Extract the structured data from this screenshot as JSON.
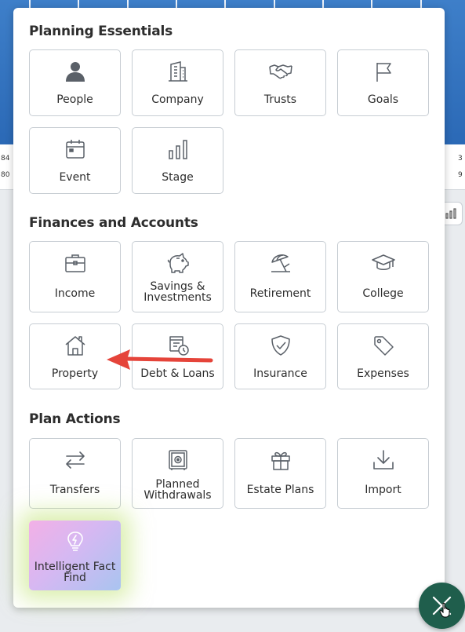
{
  "background": {
    "left_numbers": [
      "84",
      "80"
    ],
    "right_numbers": [
      "3",
      "9"
    ]
  },
  "sections": {
    "planning": {
      "title": "Planning Essentials",
      "tiles": [
        {
          "label": "People",
          "icon": "person-icon"
        },
        {
          "label": "Company",
          "icon": "building-icon"
        },
        {
          "label": "Trusts",
          "icon": "handshake-icon"
        },
        {
          "label": "Goals",
          "icon": "flag-icon"
        },
        {
          "label": "Event",
          "icon": "calendar-icon"
        },
        {
          "label": "Stage",
          "icon": "bar-chart-icon"
        }
      ]
    },
    "finances": {
      "title": "Finances and Accounts",
      "tiles": [
        {
          "label": "Income",
          "icon": "briefcase-icon"
        },
        {
          "label": "Savings & Investments",
          "line1": "Savings &",
          "line2": "Investments",
          "icon": "piggy-bank-icon"
        },
        {
          "label": "Retirement",
          "icon": "beach-umbrella-icon"
        },
        {
          "label": "College",
          "icon": "graduation-cap-icon"
        },
        {
          "label": "Property",
          "icon": "house-icon"
        },
        {
          "label": "Debt & Loans",
          "icon": "bill-clock-icon"
        },
        {
          "label": "Insurance",
          "icon": "shield-check-icon"
        },
        {
          "label": "Expenses",
          "icon": "price-tag-icon"
        }
      ]
    },
    "actions": {
      "title": "Plan Actions",
      "tiles": [
        {
          "label": "Transfers",
          "icon": "transfer-arrows-icon"
        },
        {
          "label": "Planned Withdrawals",
          "line1": "Planned",
          "line2": "Withdrawals",
          "icon": "safe-icon"
        },
        {
          "label": "Estate Plans",
          "icon": "gift-icon"
        },
        {
          "label": "Import",
          "icon": "download-icon"
        },
        {
          "label": "Intelligent Fact Find",
          "line1": "Intelligent Fact",
          "line2": "Find",
          "icon": "lightbulb-bolt-icon"
        }
      ]
    }
  },
  "colors": {
    "header_blue": "#2b69b6",
    "fab_green": "#1f5e4c",
    "arrow_red": "#e5443a",
    "tile_border": "#c7cdd3"
  }
}
